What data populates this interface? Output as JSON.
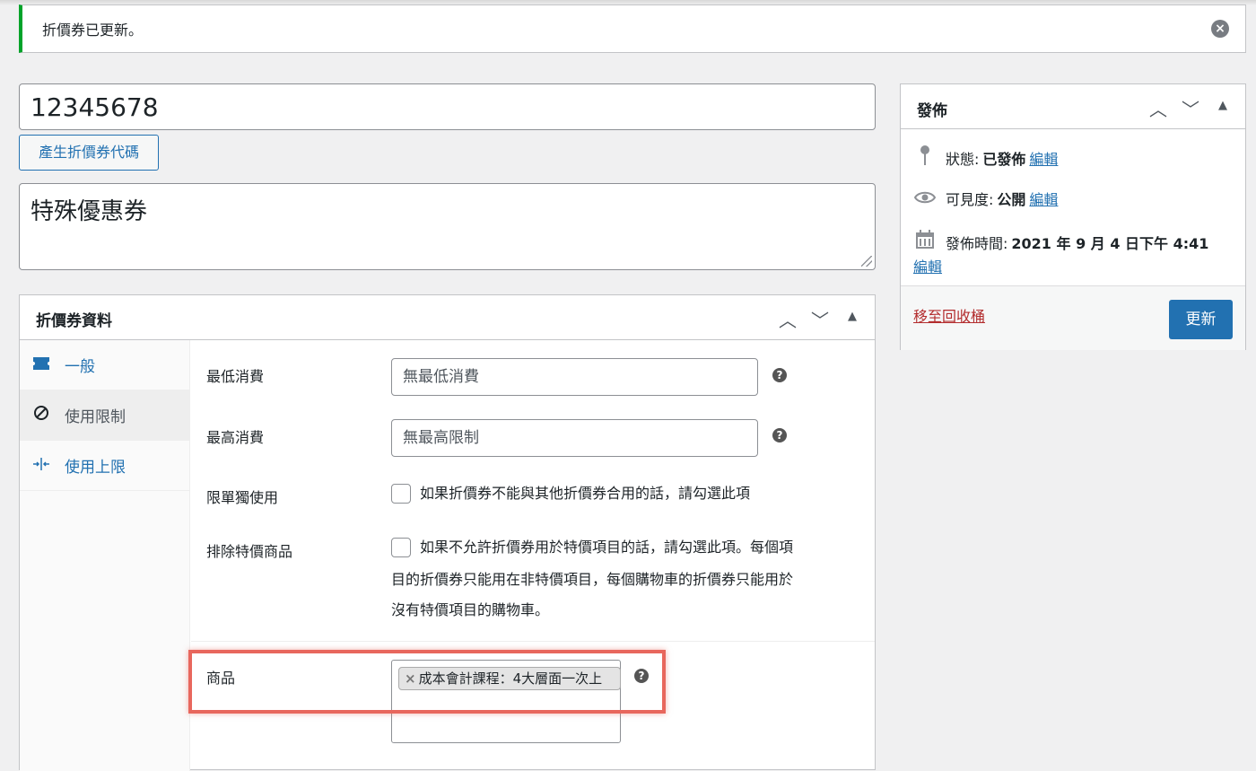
{
  "notice": {
    "text": "折價券已更新。",
    "dismiss_icon": "close-circle-icon"
  },
  "coupon": {
    "code_value": "12345678",
    "generate_button": "產生折價券代碼",
    "description": "特殊優惠券"
  },
  "coupon_data": {
    "title": "折價券資料",
    "tabs": [
      {
        "label": "一般",
        "icon": "ticket-icon"
      },
      {
        "label": "使用限制",
        "icon": "no-entry-icon"
      },
      {
        "label": "使用上限",
        "icon": "limit-arrows-icon"
      }
    ],
    "fields": {
      "min_spend_label": "最低消費",
      "min_spend_placeholder": "無最低消費",
      "max_spend_label": "最高消費",
      "max_spend_placeholder": "無最高限制",
      "individual_use_label": "限單獨使用",
      "individual_use_text": "如果折價券不能與其他折價券合用的話，請勾選此項",
      "exclude_sale_label": "排除特價商品",
      "exclude_sale_text_1": "如果不允許折價券用於特價項目的話，請勾選此項。每個項",
      "exclude_sale_text_2": "目的折價券只能用在非特價項目，每個購物車的折價券只能用於",
      "exclude_sale_text_3": "沒有特價項目的購物車。",
      "products_label": "商品",
      "product_chip": "成本會計課程：4大層面一次上"
    }
  },
  "publish": {
    "title": "發佈",
    "status_label": "狀態:",
    "status_value": "已發佈",
    "visibility_label": "可見度:",
    "visibility_value": "公開",
    "published_label": "發佈時間:",
    "published_value": "2021 年 9 月 4 日下午 4:41",
    "edit_link": "編輯",
    "trash_link": "移至回收桶",
    "update_button": "更新"
  },
  "colors": {
    "accent": "#2271b1",
    "success": "#00a32a",
    "danger": "#b32d2e",
    "highlight": "#e8675d"
  }
}
